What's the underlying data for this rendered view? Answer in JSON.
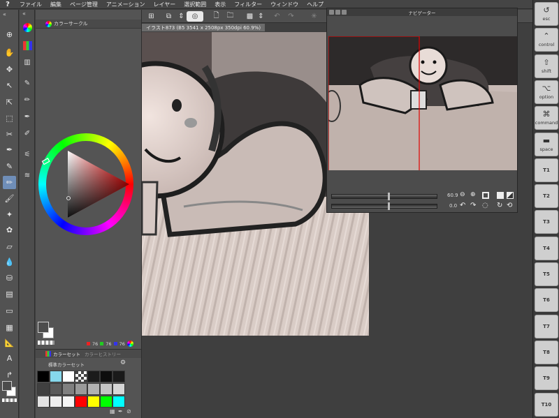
{
  "menubar": {
    "logo": "?",
    "items": [
      "ファイル",
      "編集",
      "ページ管理",
      "アニメーション",
      "レイヤー",
      "選択範囲",
      "表示",
      "フィルター",
      "ウィンドウ",
      "ヘルプ"
    ]
  },
  "color_panel": {
    "title": "カラーサークル",
    "values": {
      "r": "76",
      "g": "76",
      "b": "76"
    }
  },
  "color_set": {
    "tabs": [
      "カラーセット",
      "カラーヒストリー"
    ],
    "set_name": "標準カラーセット",
    "swatches": [
      [
        "#000000",
        "#86d8ec",
        "#ffffff",
        "checker",
        "#1b1b1b",
        "#0d0d0d",
        "#1a1a1a"
      ],
      [
        "#404040",
        "#5a5a5a",
        "#808080",
        "#9a9a9a",
        "#b2b2b2",
        "#c4c4c4",
        "#d6d6d6"
      ],
      [
        "#e3e3e3",
        "#eeeeee",
        "#f5f5f5",
        "#ff0000",
        "#ffff00",
        "#00ff00",
        "#00ffff"
      ]
    ]
  },
  "canvas": {
    "document_tab": "イラスト873 (B5 3541 x 2508px 350dpi 60.9%)"
  },
  "navigator": {
    "title": "ナビゲーター",
    "zoom": "60.9",
    "rotation": "0.0"
  },
  "shortcuts": [
    {
      "glyph": "↺",
      "label": "esc"
    },
    {
      "glyph": "⌃",
      "label": "control"
    },
    {
      "glyph": "⇧",
      "label": "shift"
    },
    {
      "glyph": "⌥",
      "label": "option"
    },
    {
      "glyph": "⌘",
      "label": "command"
    },
    {
      "glyph": "▬",
      "label": "space"
    },
    {
      "glyph": "",
      "label": "T1"
    },
    {
      "glyph": "",
      "label": "T2"
    },
    {
      "glyph": "",
      "label": "T3"
    },
    {
      "glyph": "",
      "label": "T4"
    },
    {
      "glyph": "",
      "label": "T5"
    },
    {
      "glyph": "",
      "label": "T6"
    },
    {
      "glyph": "",
      "label": "T7"
    },
    {
      "glyph": "",
      "label": "T8"
    },
    {
      "glyph": "",
      "label": "T9"
    },
    {
      "glyph": "",
      "label": "T10"
    }
  ],
  "tools": [
    {
      "icon": "zoom-icon",
      "glyph": "⊕"
    },
    {
      "icon": "hand-icon",
      "glyph": "✋"
    },
    {
      "icon": "move-icon",
      "glyph": "✥"
    },
    {
      "icon": "operation-icon",
      "glyph": "↖"
    },
    {
      "icon": "layer-move-icon",
      "glyph": "⇱"
    },
    {
      "icon": "selection-icon",
      "glyph": "⬚"
    },
    {
      "icon": "lasso-icon",
      "glyph": "✂"
    },
    {
      "icon": "eyedropper-icon",
      "glyph": "✒"
    },
    {
      "icon": "pen-icon",
      "glyph": "✎"
    },
    {
      "icon": "pencil-icon",
      "glyph": "✏"
    },
    {
      "icon": "brush-icon",
      "glyph": "🖌"
    },
    {
      "icon": "airbrush-icon",
      "glyph": "✦"
    },
    {
      "icon": "decoration-icon",
      "glyph": "✿"
    },
    {
      "icon": "eraser-icon",
      "glyph": "▱"
    },
    {
      "icon": "blend-icon",
      "glyph": "💧"
    },
    {
      "icon": "fill-icon",
      "glyph": "⛁"
    },
    {
      "icon": "gradient-icon",
      "glyph": "▤"
    },
    {
      "icon": "figure-icon",
      "glyph": "▭"
    },
    {
      "icon": "frame-icon",
      "glyph": "▦"
    },
    {
      "icon": "ruler-icon",
      "glyph": "📐"
    },
    {
      "icon": "text-icon",
      "glyph": "A"
    },
    {
      "icon": "balloon-icon",
      "glyph": "↱"
    },
    {
      "icon": "correct-line-icon",
      "glyph": "✐"
    }
  ],
  "colors": {
    "main": "#4c4c4c",
    "sub": "#ffffff",
    "accent": "#6f8eb8"
  }
}
